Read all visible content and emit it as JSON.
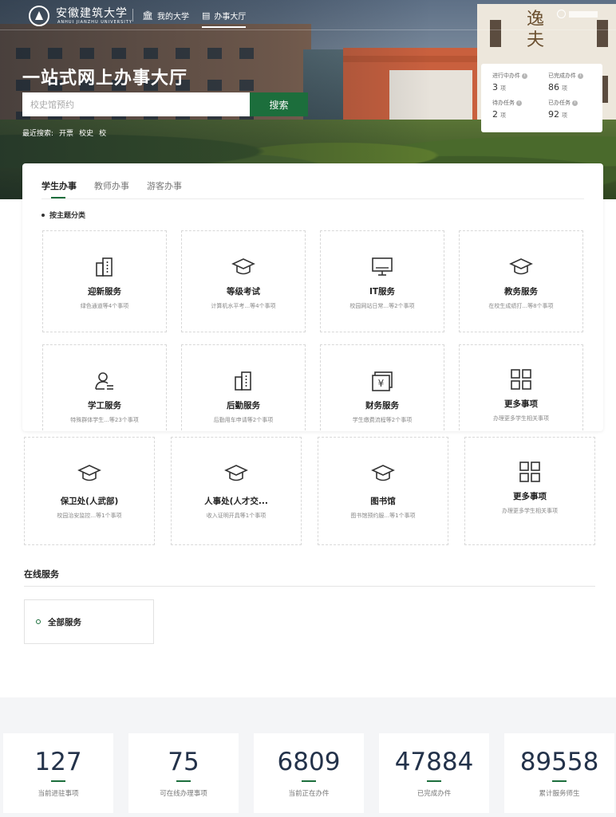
{
  "header": {
    "school_name": "安徽建筑大学",
    "school_name_en": "ANHUI JIANZHU UNIVERSITY",
    "nav": [
      {
        "label": "我的大学",
        "icon": "bank-icon"
      },
      {
        "label": "办事大厅",
        "icon": "building-icon"
      }
    ]
  },
  "hero": {
    "title": "一站式网上办事大厅",
    "search_placeholder": "校史馆预约",
    "search_button": "搜索",
    "recent_label": "最近搜索:",
    "recent_items": [
      "开票",
      "校史",
      "校"
    ],
    "calligraphy": "逸夫"
  },
  "stats_card": [
    {
      "label": "进行中办件",
      "value": "3",
      "unit": "项"
    },
    {
      "label": "已完成办件",
      "value": "86",
      "unit": "项"
    },
    {
      "label": "待办任务",
      "value": "2",
      "unit": "项"
    },
    {
      "label": "已办任务",
      "value": "92",
      "unit": "项"
    }
  ],
  "tabs": [
    "学生办事",
    "教师办事",
    "游客办事"
  ],
  "category_title": "按主题分类",
  "cards_row1": [
    {
      "title": "迎新服务",
      "sub": "绿色通道等4个事项",
      "icon": "building-icon"
    },
    {
      "title": "等级考试",
      "sub": "计算机水平考...等4个事项",
      "icon": "graduation-cap-icon"
    },
    {
      "title": "IT服务",
      "sub": "校园网站日常...等2个事项",
      "icon": "monitor-icon"
    },
    {
      "title": "教务服务",
      "sub": "在校生成绩打...等8个事项",
      "icon": "graduation-cap-icon"
    }
  ],
  "cards_row2": [
    {
      "title": "学工服务",
      "sub": "特殊群体学生...等23个事项",
      "icon": "user-list-icon"
    },
    {
      "title": "后勤服务",
      "sub": "后勤用车申请等2个事项",
      "icon": "building-icon"
    },
    {
      "title": "财务服务",
      "sub": "学生缴费流程等2个事项",
      "icon": "yen-icon"
    },
    {
      "title": "更多事项",
      "sub": "办理更多学生相关事项",
      "icon": "grid-icon"
    }
  ],
  "cards_row3": [
    {
      "title": "保卫处(人武部)",
      "sub": "校园治安监控...等1个事项",
      "icon": "graduation-cap-icon"
    },
    {
      "title": "人事处(人才交...",
      "sub": "收入证明开具等1个事项",
      "icon": "graduation-cap-icon"
    },
    {
      "title": "图书馆",
      "sub": "图书馆预约服...等1个事项",
      "icon": "graduation-cap-icon"
    },
    {
      "title": "更多事项",
      "sub": "办理更多学生相关事项",
      "icon": "grid-icon"
    }
  ],
  "online": {
    "title": "在线服务",
    "all_services": "全部服务"
  },
  "bottom_stats": [
    {
      "value": "127",
      "label": "当前进驻事项"
    },
    {
      "value": "75",
      "label": "可在线办理事项"
    },
    {
      "value": "6809",
      "label": "当前正在办件"
    },
    {
      "value": "47884",
      "label": "已完成办件"
    },
    {
      "value": "89558",
      "label": "累计服务师生"
    }
  ],
  "colors": {
    "accent": "#1c6e3c",
    "number": "#23324a"
  }
}
